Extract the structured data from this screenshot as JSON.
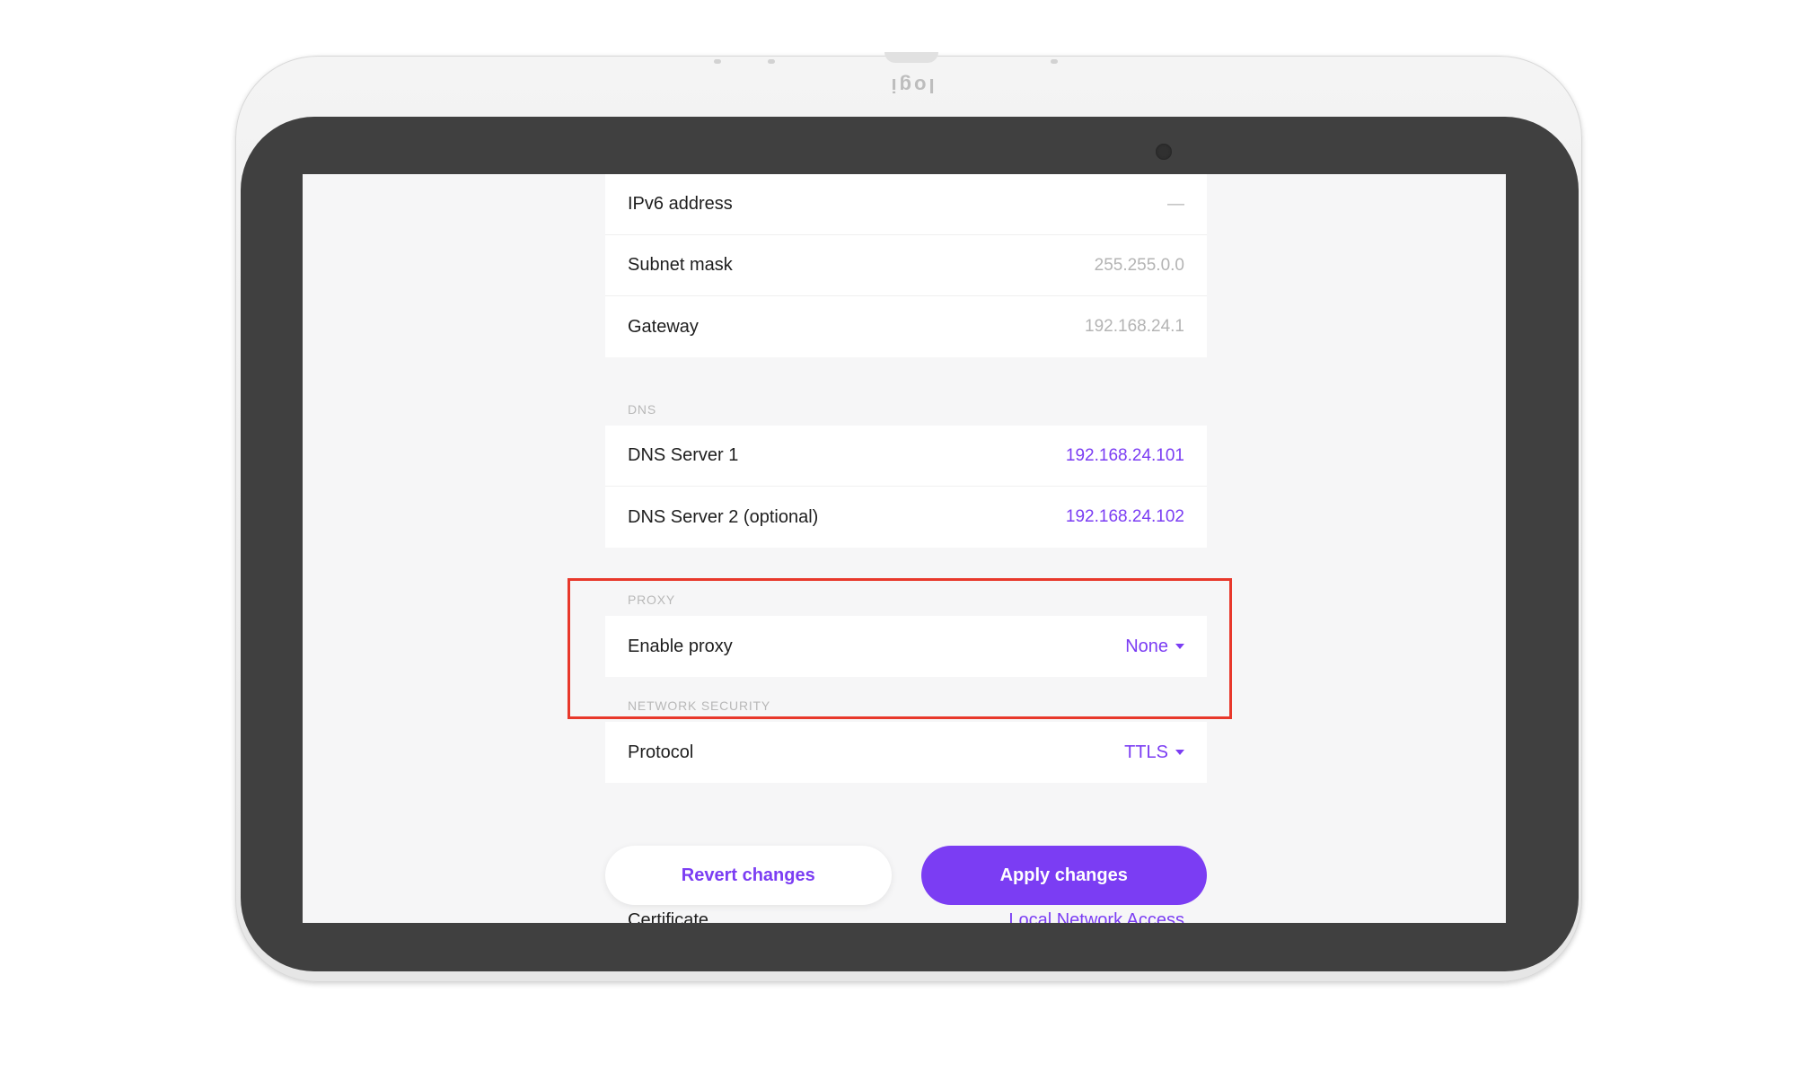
{
  "device": {
    "logo_text": "logi"
  },
  "network": {
    "top_rows": [
      {
        "label": "IPv6 address",
        "value": "—"
      },
      {
        "label": "Subnet mask",
        "value": "255.255.0.0"
      },
      {
        "label": "Gateway",
        "value": "192.168.24.1"
      }
    ],
    "dns": {
      "header": "DNS",
      "rows": [
        {
          "label": "DNS Server 1",
          "value": "192.168.24.101"
        },
        {
          "label": "DNS Server 2 (optional)",
          "value": "192.168.24.102"
        }
      ]
    },
    "proxy": {
      "header": "PROXY",
      "label": "Enable proxy",
      "value": "None"
    },
    "security": {
      "header": "NETWORK SECURITY",
      "label": "Protocol",
      "value": "TTLS"
    },
    "peek_row": {
      "label": "Certificate",
      "value": "Local Network Access"
    }
  },
  "actions": {
    "revert_label": "Revert changes",
    "apply_label": "Apply changes"
  },
  "colors": {
    "accent": "#7b3df3",
    "highlight": "#e8382b"
  }
}
